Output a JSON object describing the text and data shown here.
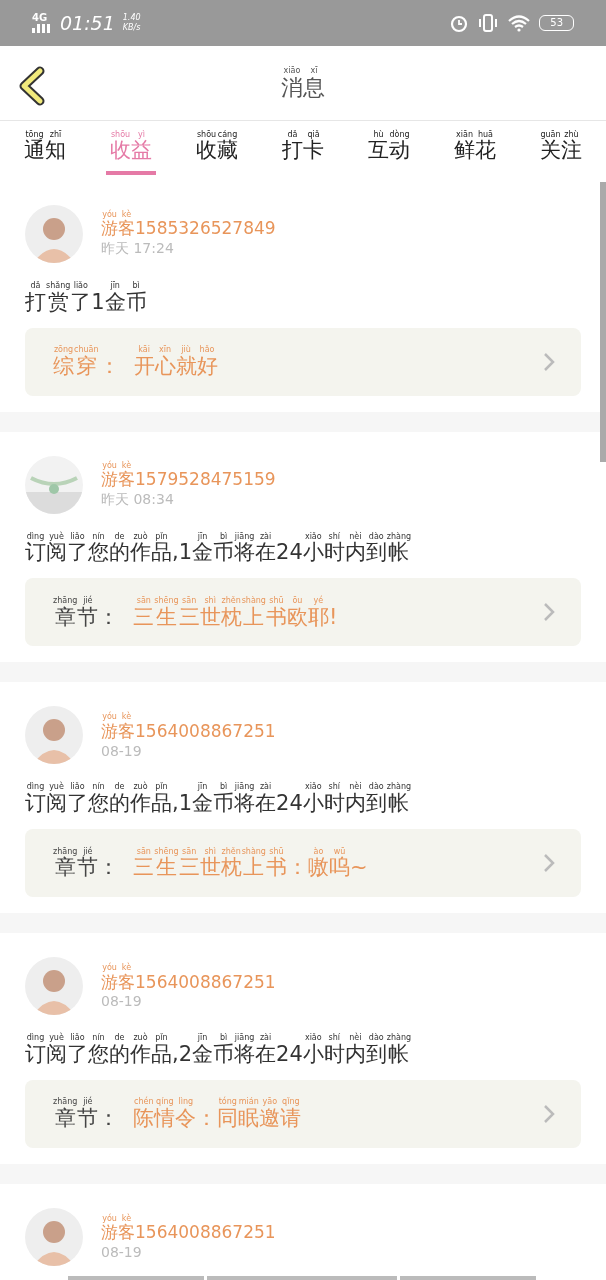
{
  "status_bar": {
    "network": "4G",
    "time": "01:51",
    "speed": "1.40",
    "speed_unit": "KB/s",
    "battery": "53"
  },
  "header": {
    "title": [
      {
        "py": "xiāo",
        "hz": "消"
      },
      {
        "py": "xī",
        "hz": "息"
      }
    ]
  },
  "tabs": [
    {
      "label": [
        {
          "py": "tōng",
          "hz": "通"
        },
        {
          "py": "zhī",
          "hz": "知"
        }
      ],
      "selected": false
    },
    {
      "label": [
        {
          "py": "shōu",
          "hz": "收"
        },
        {
          "py": "yì",
          "hz": "益"
        }
      ],
      "selected": true
    },
    {
      "label": [
        {
          "py": "shōu",
          "hz": "收"
        },
        {
          "py": "cáng",
          "hz": "藏"
        }
      ],
      "selected": false
    },
    {
      "label": [
        {
          "py": "dǎ",
          "hz": "打"
        },
        {
          "py": "qiǎ",
          "hz": "卡"
        }
      ],
      "selected": false
    },
    {
      "label": [
        {
          "py": "hù",
          "hz": "互"
        },
        {
          "py": "dòng",
          "hz": "动"
        }
      ],
      "selected": false
    },
    {
      "label": [
        {
          "py": "xiān",
          "hz": "鲜"
        },
        {
          "py": "huā",
          "hz": "花"
        }
      ],
      "selected": false
    },
    {
      "label": [
        {
          "py": "guān",
          "hz": "关"
        },
        {
          "py": "zhù",
          "hz": "注"
        }
      ],
      "selected": false
    }
  ],
  "messages": [
    {
      "avatar": {
        "kind": "person"
      },
      "user": [
        {
          "py": "yóu",
          "hz": "游"
        },
        {
          "py": "kè",
          "hz": "客"
        },
        {
          "hz": "1585326527849"
        }
      ],
      "time": "昨天 17:24",
      "content": [
        {
          "py": "dǎ",
          "hz": "打"
        },
        {
          "py": "shǎng",
          "hz": "赏"
        },
        {
          "py": "liǎo",
          "hz": "了"
        },
        {
          "hz": "1"
        },
        {
          "py": "jīn",
          "hz": "金"
        },
        {
          "py": "bì",
          "hz": "币"
        }
      ],
      "card": {
        "label_accent": true,
        "label": [
          {
            "py": "zōng",
            "hz": "综"
          },
          {
            "py": "chuān",
            "hz": "穿"
          },
          {
            "hz": "："
          }
        ],
        "value": [
          {
            "py": "kāi",
            "hz": "开"
          },
          {
            "py": "xīn",
            "hz": "心"
          },
          {
            "py": "jiù",
            "hz": "就"
          },
          {
            "py": "hǎo",
            "hz": "好"
          }
        ]
      }
    },
    {
      "avatar": {
        "kind": "picture"
      },
      "user": [
        {
          "py": "yóu",
          "hz": "游"
        },
        {
          "py": "kè",
          "hz": "客"
        },
        {
          "hz": "1579528475159"
        }
      ],
      "time": "昨天 08:34",
      "content": [
        {
          "py": "dìng",
          "hz": "订"
        },
        {
          "py": "yuè",
          "hz": "阅"
        },
        {
          "py": "liǎo",
          "hz": "了"
        },
        {
          "py": "nín",
          "hz": "您"
        },
        {
          "py": "de",
          "hz": "的"
        },
        {
          "py": "zuò",
          "hz": "作"
        },
        {
          "py": "pǐn",
          "hz": "品"
        },
        {
          "hz": ",1"
        },
        {
          "py": "jīn",
          "hz": "金"
        },
        {
          "py": "bì",
          "hz": "币"
        },
        {
          "py": "jiāng",
          "hz": "将"
        },
        {
          "py": "zài",
          "hz": "在"
        },
        {
          "hz": "24"
        },
        {
          "py": "xiǎo",
          "hz": "小"
        },
        {
          "py": "shí",
          "hz": "时"
        },
        {
          "py": "nèi",
          "hz": "内"
        },
        {
          "py": "dào",
          "hz": "到"
        },
        {
          "py": "zhàng",
          "hz": "帐"
        }
      ],
      "card": {
        "label_accent": false,
        "label": [
          {
            "py": "zhāng",
            "hz": "章"
          },
          {
            "py": "jié",
            "hz": "节"
          },
          {
            "hz": "："
          }
        ],
        "value": [
          {
            "py": "sān",
            "hz": "三"
          },
          {
            "py": "shēng",
            "hz": "生"
          },
          {
            "py": "sān",
            "hz": "三"
          },
          {
            "py": "shì",
            "hz": "世"
          },
          {
            "py": "zhěn",
            "hz": "枕"
          },
          {
            "py": "shàng",
            "hz": "上"
          },
          {
            "py": "shū",
            "hz": "书"
          },
          {
            "py": "ōu",
            "hz": "欧"
          },
          {
            "py": "yé",
            "hz": "耶"
          },
          {
            "hz": "!"
          }
        ]
      }
    },
    {
      "avatar": {
        "kind": "person"
      },
      "user": [
        {
          "py": "yóu",
          "hz": "游"
        },
        {
          "py": "kè",
          "hz": "客"
        },
        {
          "hz": "1564008867251"
        }
      ],
      "time": "08-19",
      "content": [
        {
          "py": "dìng",
          "hz": "订"
        },
        {
          "py": "yuè",
          "hz": "阅"
        },
        {
          "py": "liǎo",
          "hz": "了"
        },
        {
          "py": "nín",
          "hz": "您"
        },
        {
          "py": "de",
          "hz": "的"
        },
        {
          "py": "zuò",
          "hz": "作"
        },
        {
          "py": "pǐn",
          "hz": "品"
        },
        {
          "hz": ",1"
        },
        {
          "py": "jīn",
          "hz": "金"
        },
        {
          "py": "bì",
          "hz": "币"
        },
        {
          "py": "jiāng",
          "hz": "将"
        },
        {
          "py": "zài",
          "hz": "在"
        },
        {
          "hz": "24"
        },
        {
          "py": "xiǎo",
          "hz": "小"
        },
        {
          "py": "shí",
          "hz": "时"
        },
        {
          "py": "nèi",
          "hz": "内"
        },
        {
          "py": "dào",
          "hz": "到"
        },
        {
          "py": "zhàng",
          "hz": "帐"
        }
      ],
      "card": {
        "label_accent": false,
        "label": [
          {
            "py": "zhāng",
            "hz": "章"
          },
          {
            "py": "jié",
            "hz": "节"
          },
          {
            "hz": "："
          }
        ],
        "value": [
          {
            "py": "sān",
            "hz": "三"
          },
          {
            "py": "shēng",
            "hz": "生"
          },
          {
            "py": "sān",
            "hz": "三"
          },
          {
            "py": "shì",
            "hz": "世"
          },
          {
            "py": "zhěn",
            "hz": "枕"
          },
          {
            "py": "shàng",
            "hz": "上"
          },
          {
            "py": "shū",
            "hz": "书"
          },
          {
            "hz": "："
          },
          {
            "py": "ào",
            "hz": "嗷"
          },
          {
            "py": "wū",
            "hz": "呜"
          },
          {
            "hz": "~"
          }
        ]
      }
    },
    {
      "avatar": {
        "kind": "person"
      },
      "user": [
        {
          "py": "yóu",
          "hz": "游"
        },
        {
          "py": "kè",
          "hz": "客"
        },
        {
          "hz": "1564008867251"
        }
      ],
      "time": "08-19",
      "content": [
        {
          "py": "dìng",
          "hz": "订"
        },
        {
          "py": "yuè",
          "hz": "阅"
        },
        {
          "py": "liǎo",
          "hz": "了"
        },
        {
          "py": "nín",
          "hz": "您"
        },
        {
          "py": "de",
          "hz": "的"
        },
        {
          "py": "zuò",
          "hz": "作"
        },
        {
          "py": "pǐn",
          "hz": "品"
        },
        {
          "hz": ",2"
        },
        {
          "py": "jīn",
          "hz": "金"
        },
        {
          "py": "bì",
          "hz": "币"
        },
        {
          "py": "jiāng",
          "hz": "将"
        },
        {
          "py": "zài",
          "hz": "在"
        },
        {
          "hz": "24"
        },
        {
          "py": "xiǎo",
          "hz": "小"
        },
        {
          "py": "shí",
          "hz": "时"
        },
        {
          "py": "nèi",
          "hz": "内"
        },
        {
          "py": "dào",
          "hz": "到"
        },
        {
          "py": "zhàng",
          "hz": "帐"
        }
      ],
      "card": {
        "label_accent": false,
        "label": [
          {
            "py": "zhāng",
            "hz": "章"
          },
          {
            "py": "jié",
            "hz": "节"
          },
          {
            "hz": "："
          }
        ],
        "value": [
          {
            "py": "chén",
            "hz": "陈"
          },
          {
            "py": "qíng",
            "hz": "情"
          },
          {
            "py": "lìng",
            "hz": "令"
          },
          {
            "hz": "："
          },
          {
            "py": "tóng",
            "hz": "同"
          },
          {
            "py": "mián",
            "hz": "眠"
          },
          {
            "py": "yāo",
            "hz": "邀"
          },
          {
            "py": "qǐng",
            "hz": "请"
          }
        ]
      }
    },
    {
      "avatar": {
        "kind": "person"
      },
      "user": [
        {
          "py": "yóu",
          "hz": "游"
        },
        {
          "py": "kè",
          "hz": "客"
        },
        {
          "hz": "1564008867251"
        }
      ],
      "time": "08-19"
    }
  ]
}
